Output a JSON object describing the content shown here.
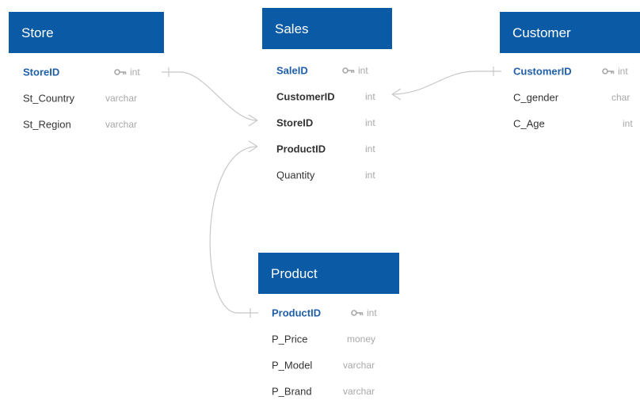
{
  "tables": {
    "store": {
      "title": "Store",
      "fields": [
        {
          "name": "StoreID",
          "type": "int",
          "pk": true
        },
        {
          "name": "St_Country",
          "type": "varchar"
        },
        {
          "name": "St_Region",
          "type": "varchar"
        }
      ]
    },
    "sales": {
      "title": "Sales",
      "fields": [
        {
          "name": "SaleID",
          "type": "int",
          "pk": true
        },
        {
          "name": "CustomerID",
          "type": "int",
          "fk": true
        },
        {
          "name": "StoreID",
          "type": "int",
          "fk": true
        },
        {
          "name": "ProductID",
          "type": "int",
          "fk": true
        },
        {
          "name": "Quantity",
          "type": "int"
        }
      ]
    },
    "customer": {
      "title": "Customer",
      "fields": [
        {
          "name": "CustomerID",
          "type": "int",
          "pk": true
        },
        {
          "name": "C_gender",
          "type": "char"
        },
        {
          "name": "C_Age",
          "type": "int"
        }
      ]
    },
    "product": {
      "title": "Product",
      "fields": [
        {
          "name": "ProductID",
          "type": "int",
          "pk": true
        },
        {
          "name": "P_Price",
          "type": "money"
        },
        {
          "name": "P_Model",
          "type": "varchar"
        },
        {
          "name": "P_Brand",
          "type": "varchar"
        }
      ]
    }
  },
  "relationships": [
    {
      "from": "Store.StoreID",
      "to": "Sales.StoreID",
      "from_end": "one",
      "to_end": "many"
    },
    {
      "from": "Customer.CustomerID",
      "to": "Sales.CustomerID",
      "from_end": "one",
      "to_end": "many"
    },
    {
      "from": "Product.ProductID",
      "to": "Sales.ProductID",
      "from_end": "one",
      "to_end": "many"
    }
  ],
  "colors": {
    "header": "#0a5aa6",
    "pk_text": "#1f5fa8",
    "connector": "#c8c8c8",
    "type_text": "#a8a8a8"
  },
  "icons": {
    "primary_key": "key-icon"
  }
}
